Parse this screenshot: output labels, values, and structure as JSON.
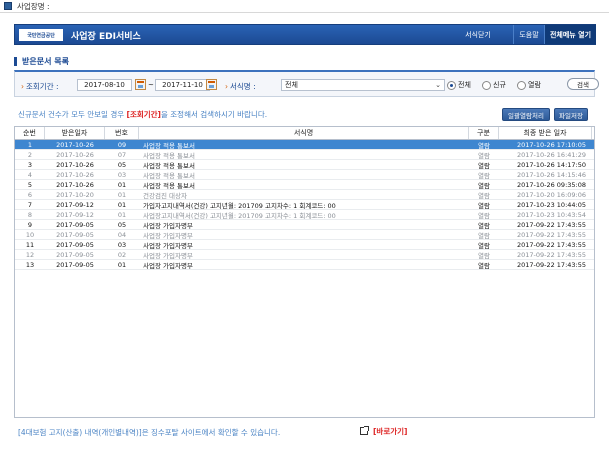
{
  "window": {
    "title": "사업장명 :"
  },
  "header": {
    "logo_text": "국민연금공단",
    "title": "사업장 EDI서비스",
    "close_label": "서식닫기",
    "help_label": "도움말",
    "menu_label": "전체메뉴 열기"
  },
  "section": {
    "title": "받은문서 목록"
  },
  "search": {
    "period_label": "조회기간 :",
    "date_from": "2017-08-10",
    "date_to": "2017-11-10",
    "tilde": "~",
    "form_label": "서식명 :",
    "form_value": "전체",
    "radio_all": "전체",
    "radio_new": "신규",
    "radio_read": "열람",
    "selected_radio": "전체",
    "search_label": "검색"
  },
  "notice": {
    "prefix": "신규문서 건수가 모두 안보일 경우 ",
    "highlight": "[조회기간]",
    "suffix": "을 조정해서 검색하시기 바랍니다."
  },
  "buttons": {
    "read_all": "일괄열람처리",
    "save_file": "파일저장"
  },
  "table": {
    "headers": [
      "순번",
      "받은일자",
      "번호",
      "서식명",
      "구분",
      "최종 받은 일자"
    ],
    "rows": [
      {
        "no": "1",
        "date": "2017-10-26",
        "num": "09",
        "form": "사업장 적용 통보서",
        "status": "열람",
        "last": "2017-10-26 17:10:05",
        "state": "sel"
      },
      {
        "no": "2",
        "date": "2017-10-26",
        "num": "07",
        "form": "사업장 적용 통보서",
        "status": "열람",
        "last": "2017-10-26 16:41:29",
        "state": "read"
      },
      {
        "no": "3",
        "date": "2017-10-26",
        "num": "05",
        "form": "사업장 적용 통보서",
        "status": "열람",
        "last": "2017-10-26 14:17:50",
        "state": "unread"
      },
      {
        "no": "4",
        "date": "2017-10-26",
        "num": "03",
        "form": "사업장 적용 통보서",
        "status": "열람",
        "last": "2017-10-26 14:15:46",
        "state": "read"
      },
      {
        "no": "5",
        "date": "2017-10-26",
        "num": "01",
        "form": "사업장 적용 통보서",
        "status": "열람",
        "last": "2017-10-26 09:35:08",
        "state": "unread"
      },
      {
        "no": "6",
        "date": "2017-10-20",
        "num": "01",
        "form": "건강검진 대상자",
        "status": "열람",
        "last": "2017-10-20 16:09:06",
        "state": "read"
      },
      {
        "no": "7",
        "date": "2017-09-12",
        "num": "01",
        "form": "가입자고지내역서(건강) 고지년월: 201709 고지차수: 1 회계코드: 00",
        "status": "열람",
        "last": "2017-10-23 10:44:05",
        "state": "unread"
      },
      {
        "no": "8",
        "date": "2017-09-12",
        "num": "01",
        "form": "사업장고지내역서(건강) 고지년월: 201709 고지차수: 1 회계코드: 00",
        "status": "열람",
        "last": "2017-10-23 10:43:54",
        "state": "read"
      },
      {
        "no": "9",
        "date": "2017-09-05",
        "num": "05",
        "form": "사업장 가입자명부",
        "status": "열람",
        "last": "2017-09-22 17:43:55",
        "state": "unread"
      },
      {
        "no": "10",
        "date": "2017-09-05",
        "num": "04",
        "form": "사업장 가입자명부",
        "status": "열람",
        "last": "2017-09-22 17:43:55",
        "state": "read"
      },
      {
        "no": "11",
        "date": "2017-09-05",
        "num": "03",
        "form": "사업장 가입자명부",
        "status": "열람",
        "last": "2017-09-22 17:43:55",
        "state": "unread"
      },
      {
        "no": "12",
        "date": "2017-09-05",
        "num": "02",
        "form": "사업장 가입자명부",
        "status": "열람",
        "last": "2017-09-22 17:43:55",
        "state": "read"
      },
      {
        "no": "13",
        "date": "2017-09-05",
        "num": "01",
        "form": "사업장 가입자명부",
        "status": "열람",
        "last": "2017-09-22 17:43:55",
        "state": "unread"
      }
    ]
  },
  "footer": {
    "note": "[4대보험 고지(산출) 내역(개인별내역)]은 징수포탈 사이트에서 확인할 수 있습니다.",
    "shortcut": "[바로가기]"
  },
  "colors": {
    "brand": "#1c4a93",
    "selected_row": "#3e86d0",
    "highlight": "#dd2222",
    "notice": "#4a83c4"
  }
}
